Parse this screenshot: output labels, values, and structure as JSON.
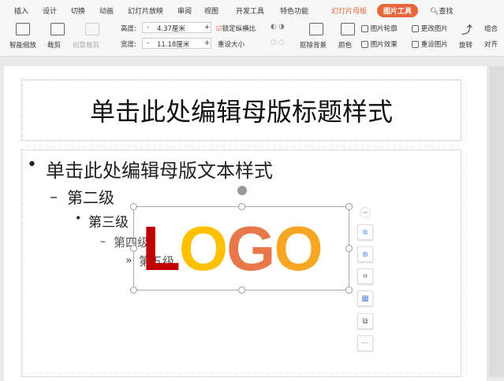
{
  "tabs": [
    "插入",
    "设计",
    "切换",
    "动画",
    "幻灯片放映",
    "审阅",
    "视图",
    "开发工具",
    "特色功能",
    "幻灯片母版",
    "图片工具",
    "查找"
  ],
  "toolbar": {
    "smart_zoom": "智能缩放",
    "crop": "裁剪",
    "create_crop": "创意裁剪",
    "height_label": "高度:",
    "height_value": "4.37厘米",
    "width_label": "宽度:",
    "width_value": "11.18厘米",
    "minus": "-",
    "plus": "+",
    "lock_ratio": "锁定纵横比",
    "reset_size": "重设大小",
    "remove_bg": "抠除背景",
    "color": "颜色",
    "outline": "图片轮廓",
    "effect": "图片效果",
    "change_pic": "更改图片",
    "reset_pic": "重设图片",
    "rotate": "旋转",
    "group": "组合",
    "align": "对齐"
  },
  "slide": {
    "title": "单击此处编辑母版标题样式",
    "levels": [
      "单击此处编辑母版文本样式",
      "第二级",
      "第三级",
      "第四级",
      "第五级"
    ],
    "bullets": [
      "•",
      "–",
      "•",
      "–",
      "»"
    ],
    "logo": [
      "L",
      "O",
      "G",
      "O"
    ]
  },
  "colors": {
    "accent": "#e5673a",
    "logo": [
      "#c00000",
      "#ffc000",
      "#e8784a",
      "#f5a623"
    ]
  },
  "float_more": "···"
}
